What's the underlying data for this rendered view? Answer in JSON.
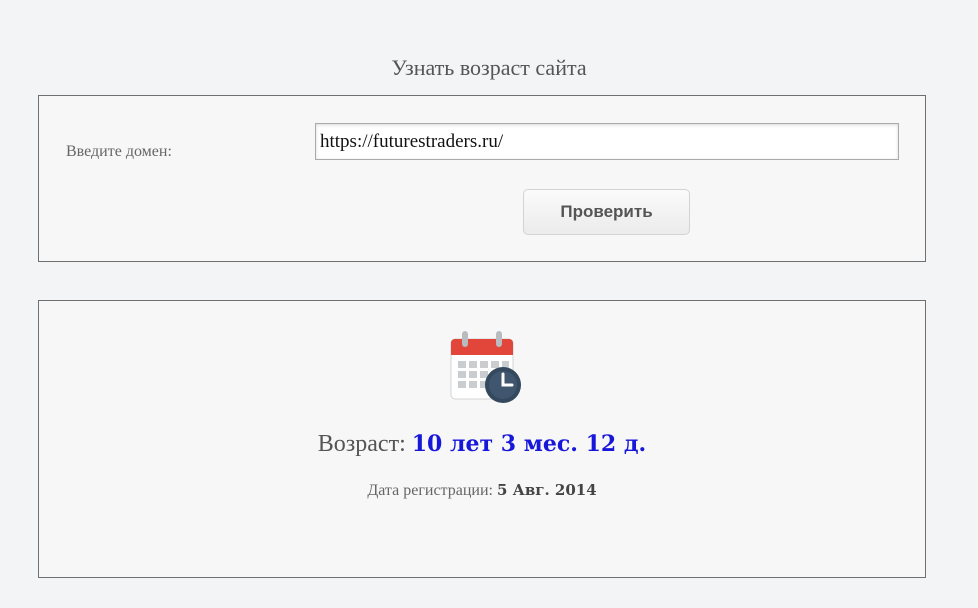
{
  "page": {
    "title": "Узнать возраст сайта"
  },
  "form": {
    "domain_label": "Введите домен:",
    "domain_value": "https://futurestraders.ru/",
    "check_button": "Проверить"
  },
  "result": {
    "icon": "calendar-clock-icon",
    "age_label": "Возраст:",
    "age_value": "10 лет 3 мес. 12 д.",
    "registration_label": "Дата регистрации:",
    "registration_value": "5 Авг. 2014"
  },
  "colors": {
    "age_value": "#1717d9",
    "calendar_header": "#e2463a",
    "clock": "#34495e"
  }
}
